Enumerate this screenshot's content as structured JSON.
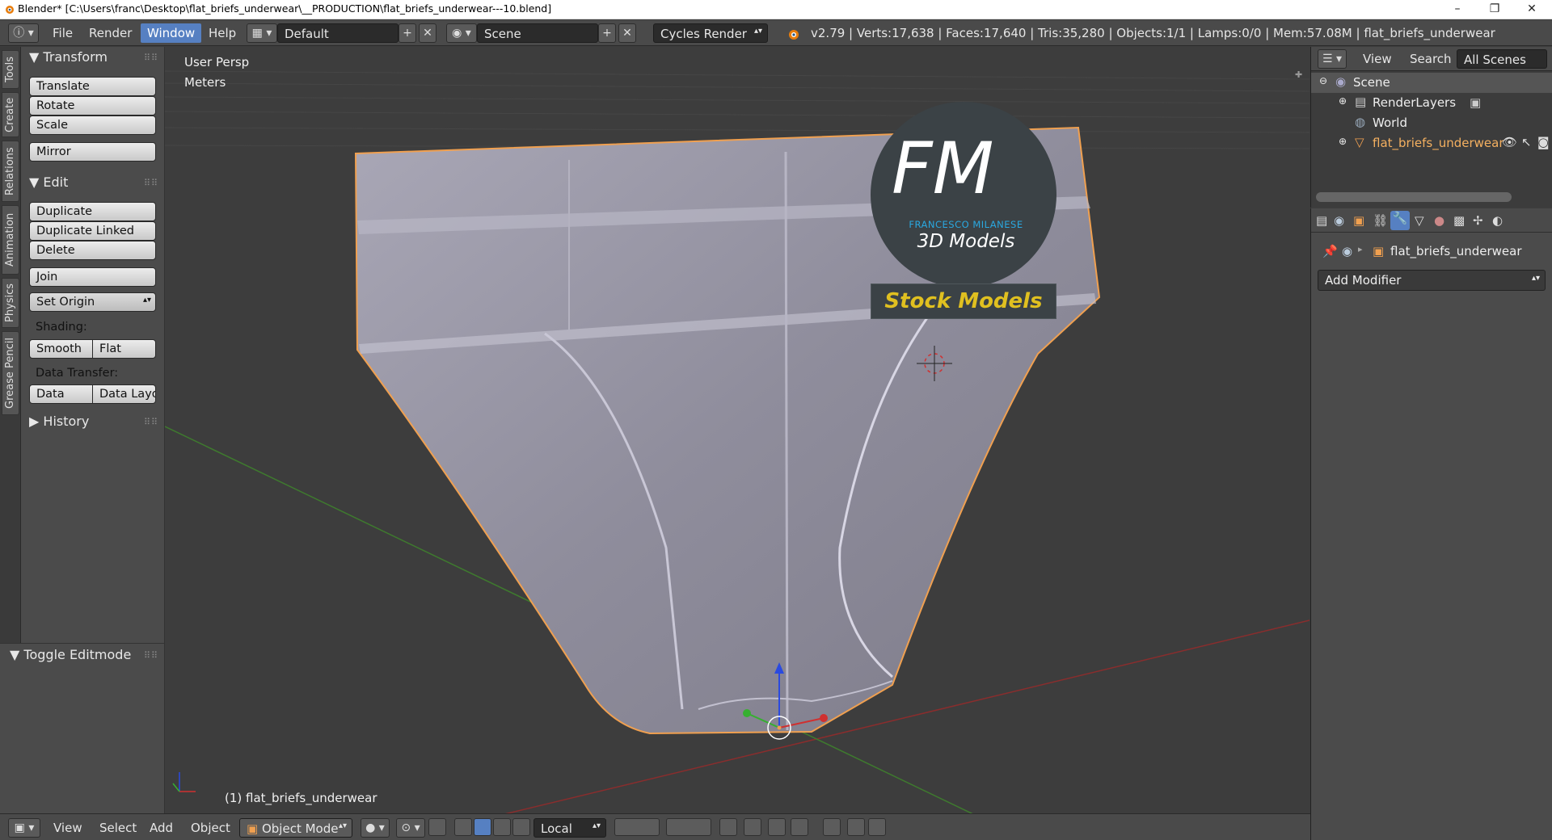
{
  "window": {
    "title": "Blender* [C:\\Users\\franc\\Desktop\\flat_briefs_underwear\\__PRODUCTION\\flat_briefs_underwear---10.blend]",
    "minimize": "–",
    "maximize": "❐",
    "close": "✕"
  },
  "top_header": {
    "menus": [
      "File",
      "Render",
      "Window",
      "Help"
    ],
    "active_menu": "Window",
    "screen_layout": "Default",
    "scene": "Scene",
    "render_engine": "Cycles Render",
    "stats": "v2.79 | Verts:17,638 | Faces:17,640 | Tris:35,280 | Objects:1/1 | Lamps:0/0 | Mem:57.08M | flat_briefs_underwear"
  },
  "left_tabs": [
    "Tools",
    "Create",
    "Relations",
    "Animation",
    "Physics",
    "Grease Pencil"
  ],
  "tool_shelf": {
    "transform": {
      "header": "Transform",
      "buttons": [
        "Translate",
        "Rotate",
        "Scale",
        "Mirror"
      ]
    },
    "edit": {
      "header": "Edit",
      "buttons": [
        "Duplicate",
        "Duplicate Linked",
        "Delete",
        "Join"
      ],
      "set_origin": "Set Origin",
      "shading_label": "Shading:",
      "shading_buttons": [
        "Smooth",
        "Flat"
      ],
      "data_transfer_label": "Data Transfer:",
      "data_transfer_buttons": [
        "Data",
        "Data Layo"
      ]
    },
    "history": {
      "header": "History"
    }
  },
  "operator_panel": {
    "header": "Toggle Editmode"
  },
  "viewport": {
    "view_name": "User Persp",
    "units": "Meters",
    "object_label": "(1) flat_briefs_underwear",
    "watermark": {
      "logo": "FM",
      "company": "FRANCESCO MILANESE",
      "tagline": "3D Models",
      "banner": "Stock Models"
    }
  },
  "outliner": {
    "menus": [
      "View",
      "Search"
    ],
    "filter": "All Scenes",
    "rows": [
      "Scene",
      "RenderLayers",
      "World",
      "flat_briefs_underwear"
    ]
  },
  "properties": {
    "object_name": "flat_briefs_underwear",
    "add_modifier": "Add Modifier"
  },
  "bottom_header": {
    "menus": [
      "View",
      "Select",
      "Add",
      "Object"
    ],
    "mode": "Object Mode",
    "orientation": "Local"
  },
  "colors": {
    "accent": "#5680c2",
    "mesh": "#8e8c9a",
    "selection_outline": "#f0a050",
    "logo_blue": "#2aa8e0",
    "banner_text": "#e0c020"
  }
}
